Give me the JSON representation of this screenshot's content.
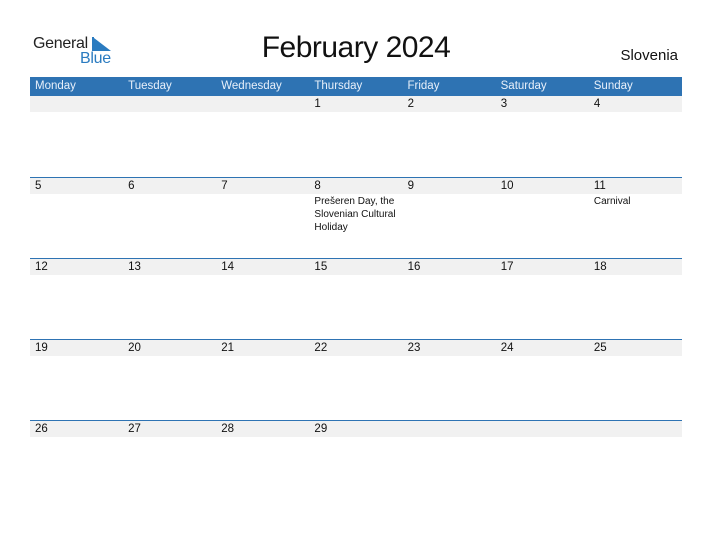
{
  "logo": {
    "line1": "General",
    "line2": "Blue"
  },
  "title": "February 2024",
  "country": "Slovenia",
  "colors": {
    "header_bg": "#2e73b3",
    "brand_blue": "#2a7bc0",
    "day_band": "#f1f1f1"
  },
  "weekdays": [
    "Monday",
    "Tuesday",
    "Wednesday",
    "Thursday",
    "Friday",
    "Saturday",
    "Sunday"
  ],
  "weeks": [
    {
      "days": [
        {
          "num": "",
          "event": ""
        },
        {
          "num": "",
          "event": ""
        },
        {
          "num": "",
          "event": ""
        },
        {
          "num": "1",
          "event": ""
        },
        {
          "num": "2",
          "event": ""
        },
        {
          "num": "3",
          "event": ""
        },
        {
          "num": "4",
          "event": ""
        }
      ]
    },
    {
      "days": [
        {
          "num": "5",
          "event": ""
        },
        {
          "num": "6",
          "event": ""
        },
        {
          "num": "7",
          "event": ""
        },
        {
          "num": "8",
          "event": "Prešeren Day, the Slovenian Cultural Holiday"
        },
        {
          "num": "9",
          "event": ""
        },
        {
          "num": "10",
          "event": ""
        },
        {
          "num": "11",
          "event": "Carnival"
        }
      ]
    },
    {
      "days": [
        {
          "num": "12",
          "event": ""
        },
        {
          "num": "13",
          "event": ""
        },
        {
          "num": "14",
          "event": ""
        },
        {
          "num": "15",
          "event": ""
        },
        {
          "num": "16",
          "event": ""
        },
        {
          "num": "17",
          "event": ""
        },
        {
          "num": "18",
          "event": ""
        }
      ]
    },
    {
      "days": [
        {
          "num": "19",
          "event": ""
        },
        {
          "num": "20",
          "event": ""
        },
        {
          "num": "21",
          "event": ""
        },
        {
          "num": "22",
          "event": ""
        },
        {
          "num": "23",
          "event": ""
        },
        {
          "num": "24",
          "event": ""
        },
        {
          "num": "25",
          "event": ""
        }
      ]
    },
    {
      "days": [
        {
          "num": "26",
          "event": ""
        },
        {
          "num": "27",
          "event": ""
        },
        {
          "num": "28",
          "event": ""
        },
        {
          "num": "29",
          "event": ""
        },
        {
          "num": "",
          "event": ""
        },
        {
          "num": "",
          "event": ""
        },
        {
          "num": "",
          "event": ""
        }
      ]
    }
  ]
}
